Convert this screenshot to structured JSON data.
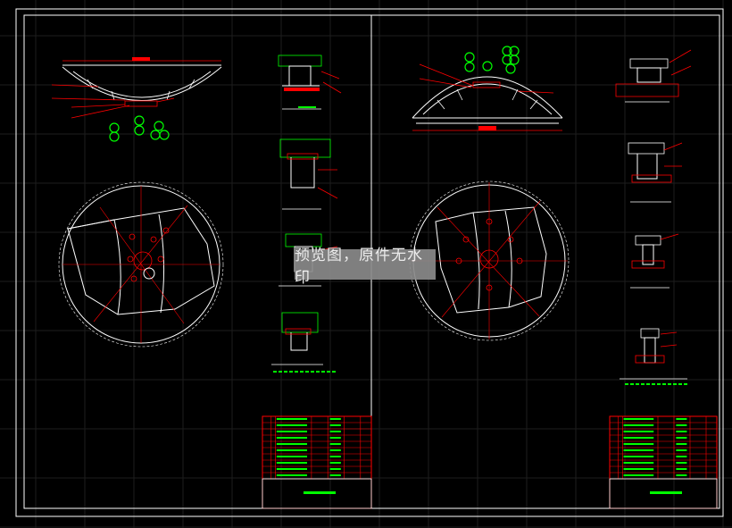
{
  "watermark": "预览图，原件无水印",
  "colors": {
    "background": "#000000",
    "border": "#ffffff",
    "linework": "#ffffff",
    "dimension": "#ff0000",
    "leader": "#ff0000",
    "annotation": "#00ff00",
    "grid": "#1e1e1e",
    "titleblock_line": "#ff0000",
    "titleblock_text": "#00ff00"
  },
  "sheets": [
    {
      "name": "left-sheet"
    },
    {
      "name": "right-sheet"
    }
  ]
}
